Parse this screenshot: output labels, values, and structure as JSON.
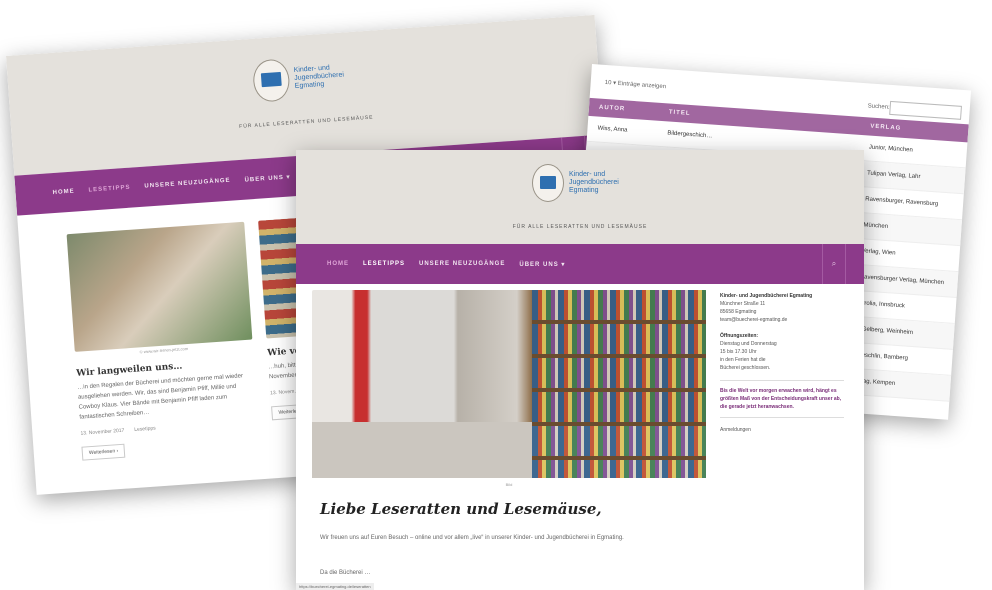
{
  "site": {
    "logo_lines": [
      "Kinder- und",
      "Jugendbücherei",
      "Egmating"
    ],
    "tagline": "FÜR ALLE LESERATTEN UND LESEMÄUSE",
    "nav": [
      "HOME",
      "LESETIPPS",
      "UNSERE NEUZUGÄNGE",
      "ÜBER UNS ▾"
    ],
    "search_icon": "⌕"
  },
  "left": {
    "active_nav": 1,
    "cards": [
      {
        "caption": "© www.wir-lernen-jetzt.com",
        "title": "Wir langweilen uns…",
        "text": "…in den Regalen der Bücherei und möchten gerne mal wieder ausgeliehen werden. Wir, das sind Benjamin Pfiff, Millie und Cowboy Klaus. Vier Bände mit Benjamin Pfiff laden zum fantastischen Schreiben…",
        "date": "13. November 2017",
        "tags": "Lesetipps",
        "more": "Weiterlesen ›"
      },
      {
        "caption": "",
        "title": "Wie verzweifelt…",
        "text": "…huh, bitte nebel Grimm… November … Wetter und…",
        "date": "13. Novem…",
        "tags": "",
        "more": "Weiterlesen ›"
      }
    ]
  },
  "right": {
    "entries_label": "Einträge anzeigen",
    "entries_value": "10",
    "search_label": "Suchen:",
    "columns": [
      "AUTOR",
      "TITEL",
      "VERLAG"
    ],
    "rows": [
      [
        "Wiss, Anna",
        "Bildergeschich…",
        "Junior, München"
      ],
      [
        "",
        "",
        "Tulipan Verlag, Lahr"
      ],
      [
        "",
        "",
        "Ravensburger, Ravensburg"
      ],
      [
        "",
        "",
        "München"
      ],
      [
        "",
        "",
        "Verlag, Wien"
      ],
      [
        "",
        "",
        "Ravensburger Verlag, München"
      ],
      [
        "",
        "",
        "Tyrolia, Innsbruck"
      ],
      [
        "",
        "",
        "& Gelberg, Weinheim"
      ],
      [
        "",
        "",
        "Baeschlin, Bamberg"
      ],
      [
        "",
        "",
        "Verlag, Kempen"
      ]
    ]
  },
  "front": {
    "active_nav": 0,
    "hero_caption": "Bild",
    "welcome_title": "Liebe Leseratten und Lesemäuse,",
    "intro": "Wir freuen uns auf Euren Besuch – online und vor allem „live“ in unserer Kinder- und Jugendbücherei in Egmating.",
    "intro2": "Da die Bücherei …",
    "sidebar": {
      "address_title": "Kinder- und Jugendbücherei Egmating",
      "address_lines": [
        "Münchner Straße 11",
        "85658 Egmating",
        "team@buecherei-egmating.de"
      ],
      "hours_title": "Öffnungszeiten:",
      "hours_lines": [
        "Dienstag und Donnerstag",
        "15 bis 17.30 Uhr",
        "in den Ferien hat die",
        "Bücherei geschlossen."
      ],
      "notice": "Bis die Welt vor morgen erwachen wird, hängt es größten Maß von der Entscheidungskraft unser ab, die gerade jetzt heranwachsen.",
      "link": "Anmeldungen"
    },
    "status_url": "https://buecherei-egmating.de/leseratten"
  }
}
